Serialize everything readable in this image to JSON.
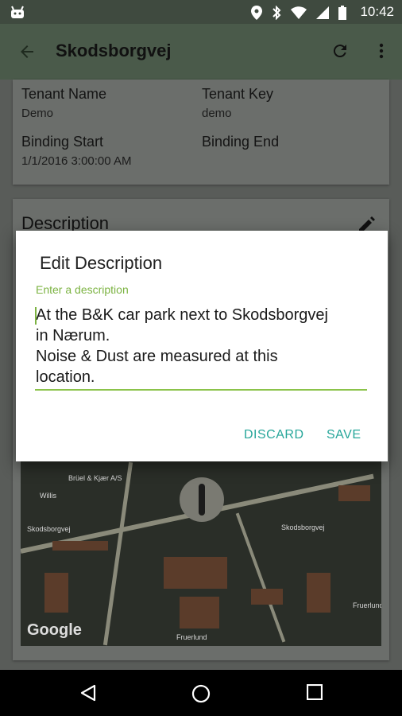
{
  "status_bar": {
    "time": "10:42"
  },
  "app_bar": {
    "title": "Skodsborgvej"
  },
  "details": {
    "tenant_name_label": "Tenant Name",
    "tenant_name_value": "Demo",
    "tenant_key_label": "Tenant Key",
    "tenant_key_value": "demo",
    "binding_start_label": "Binding Start",
    "binding_start_value": "1/1/2016 3:00:00 AM",
    "binding_end_label": "Binding End"
  },
  "description_card": {
    "title": "Description"
  },
  "map": {
    "logo": "Google",
    "labels": [
      "Brüel & Kjær A/S",
      "Willis",
      "Skodsborgvej",
      "Skodsborgvej",
      "Fruerlund",
      "Fruerlund"
    ]
  },
  "dialog": {
    "title": "Edit Description",
    "hint": "Enter a description",
    "text": "At the B&K car park next to Skodsborgvej\nin Nærum.\nNoise & Dust are measured at this\nlocation.",
    "discard_label": "DISCARD",
    "save_label": "SAVE"
  },
  "icons": {
    "back": "arrow-back-icon",
    "refresh": "refresh-icon",
    "more": "more-vert-icon",
    "edit": "pencil-icon"
  },
  "colors": {
    "accent_green": "#8bc34a",
    "button_teal": "#26a69a",
    "status_bar": "#3f4a3f"
  }
}
